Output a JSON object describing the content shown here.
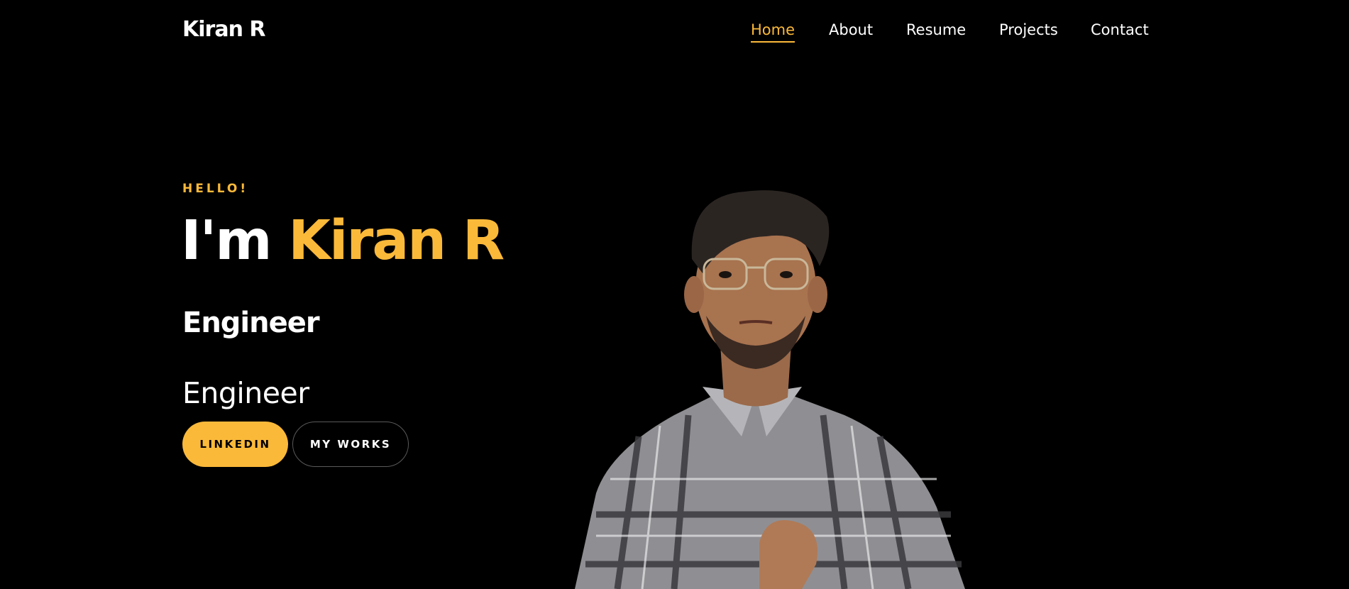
{
  "header": {
    "logo": "Kiran R",
    "nav": [
      {
        "label": "Home",
        "active": true
      },
      {
        "label": "About",
        "active": false
      },
      {
        "label": "Resume",
        "active": false
      },
      {
        "label": "Projects",
        "active": false
      },
      {
        "label": "Contact",
        "active": false
      }
    ]
  },
  "hero": {
    "greeting": "HELLO!",
    "headline_prefix": "I'm",
    "headline_name": "Kiran R",
    "role_bold": "Engineer",
    "role_typed": "Engineer",
    "buttons": {
      "linkedin": "LINKEDIN",
      "works": "MY WORKS"
    }
  },
  "colors": {
    "background": "#000000",
    "accent": "#fbb93a",
    "text": "#ffffff"
  }
}
